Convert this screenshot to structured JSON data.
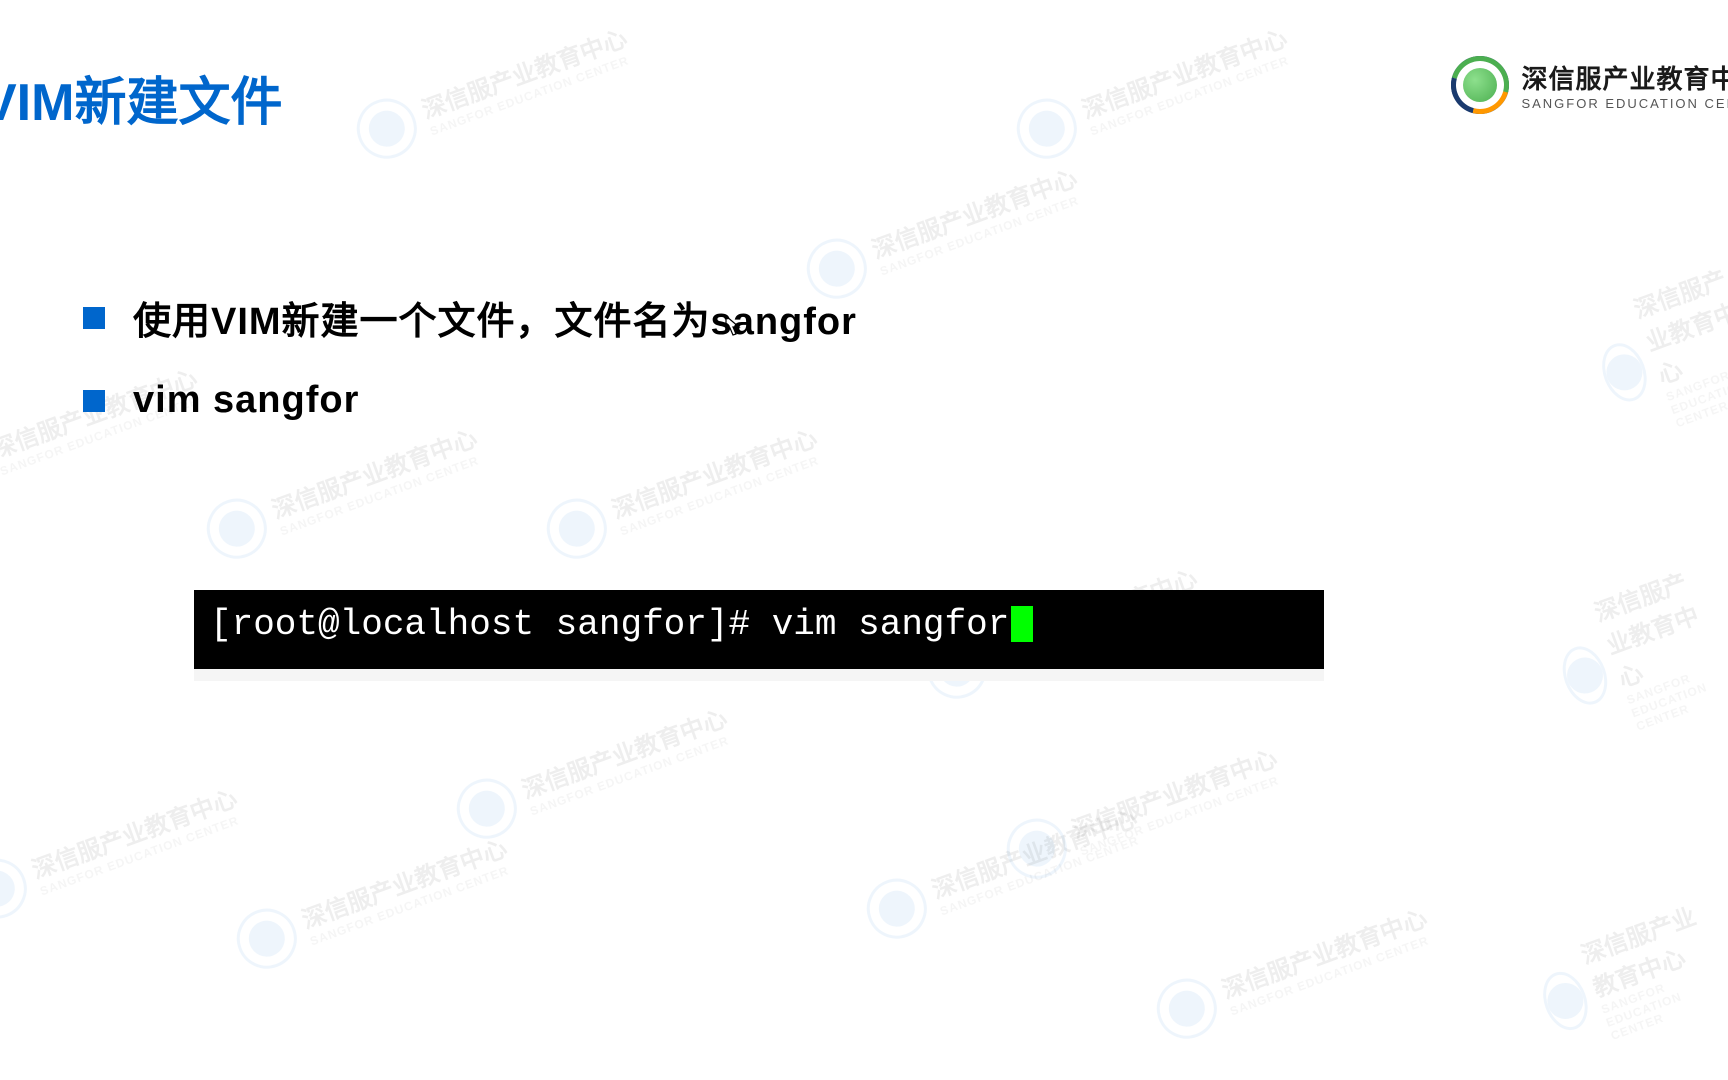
{
  "title": "VIM新建文件",
  "brand": {
    "title": "深信服产业教育中",
    "subtitle": "SANGFOR EDUCATION CEN"
  },
  "bullets": [
    "使用VIM新建一个文件，文件名为sangfor",
    "vim sangfor"
  ],
  "terminal": {
    "prompt": "[root@localhost sangfor]# ",
    "command": "vim sangfor"
  },
  "watermark": {
    "text": "深信服产业教育中心",
    "subtitle": "SANGFOR EDUCATION CENTER"
  }
}
